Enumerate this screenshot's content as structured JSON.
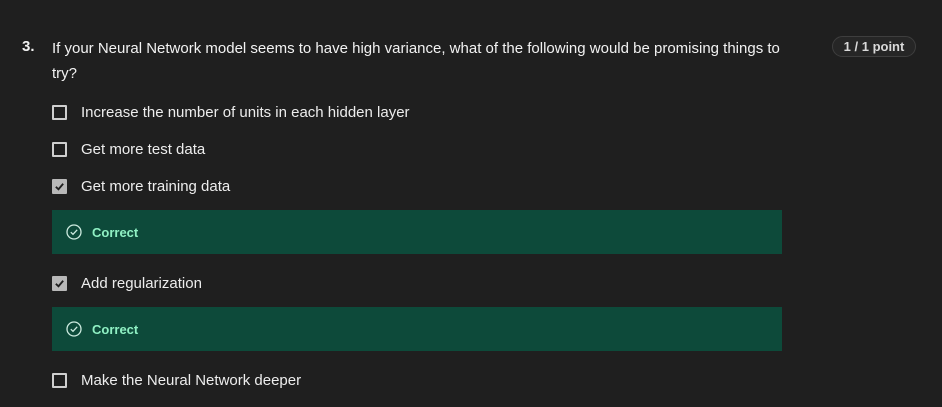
{
  "question": {
    "number": "3.",
    "text": "If your Neural Network model seems to have high variance, what of the following would be promising things to try?",
    "points": "1 / 1 point"
  },
  "options": [
    {
      "label": "Increase the number of units in each hidden layer",
      "checked": false
    },
    {
      "label": "Get more test data",
      "checked": false
    },
    {
      "label": "Get more training data",
      "checked": true,
      "feedback": "Correct"
    },
    {
      "label": "Add regularization",
      "checked": true,
      "feedback": "Correct"
    },
    {
      "label": "Make the Neural Network deeper",
      "checked": false
    }
  ],
  "icons": {
    "checkmark": "checkmark-icon",
    "feedback": "check-circle-icon"
  },
  "colors": {
    "background": "#1f1f1f",
    "correct_panel": "#0d4a3a",
    "correct_text": "#8ff0c3",
    "checkbox_checked": "#b8b8b8"
  }
}
